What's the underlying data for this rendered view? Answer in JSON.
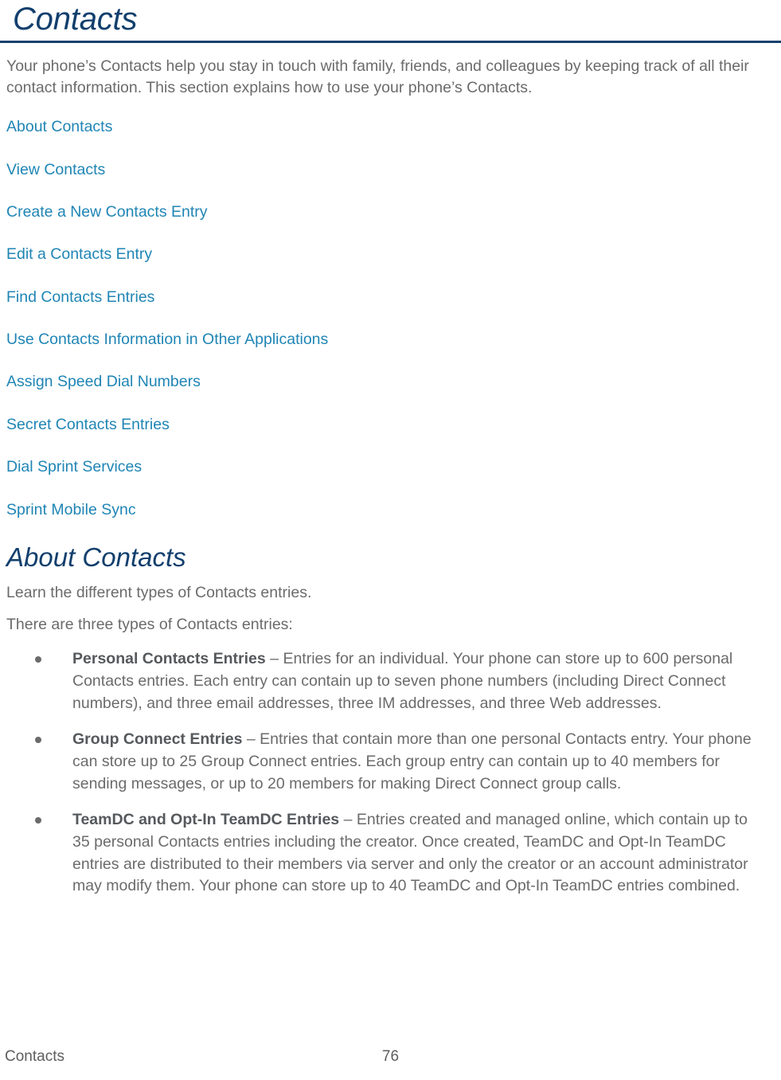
{
  "document": {
    "chapter_title": "Contacts",
    "intro_paragraph": "Your phone’s Contacts help you stay in touch with family, friends, and colleagues by keeping track of all their contact information. This section explains how to use your phone’s Contacts."
  },
  "toc": {
    "items": [
      {
        "label": "About Contacts"
      },
      {
        "label": "View Contacts"
      },
      {
        "label": "Create a New Contacts Entry"
      },
      {
        "label": "Edit a Contacts Entry"
      },
      {
        "label": "Find Contacts Entries"
      },
      {
        "label": "Use Contacts Information in Other Applications"
      },
      {
        "label": "Assign Speed Dial Numbers"
      },
      {
        "label": "Secret Contacts Entries"
      },
      {
        "label": "Dial Sprint Services"
      },
      {
        "label": "Sprint Mobile Sync"
      }
    ]
  },
  "about_section": {
    "heading": "About Contacts",
    "lead_paragraph": "Learn the different types of Contacts entries.",
    "intro_line": "There are three types of Contacts entries:",
    "entries": [
      {
        "term": "Personal Contacts Entries",
        "separator": " – ",
        "description": "Entries for an individual. Your phone can store up to 600 personal Contacts entries. Each entry can contain up to seven phone numbers (including Direct Connect numbers), and three email addresses, three IM addresses, and three Web addresses."
      },
      {
        "term": "Group Connect Entries",
        "separator": " – ",
        "description": "Entries that contain more than one personal Contacts entry. Your phone can store up to 25 Group Connect entries. Each group entry can contain up to 40 members for sending messages, or up to 20 members for making Direct Connect group calls."
      },
      {
        "term": "TeamDC and Opt-In TeamDC Entries",
        "separator": " – ",
        "description": "Entries created and managed online, which contain up to 35 personal Contacts entries including the creator. Once created, TeamDC and Opt-In TeamDC entries are distributed to their members via server and only the creator or an account administrator may modify them. Your phone can store up to 40 TeamDC and Opt-In TeamDC entries combined."
      }
    ]
  },
  "footer": {
    "section_label": "Contacts",
    "page_number": "76"
  },
  "colors": {
    "heading_navy": "#123f6d",
    "link_blue": "#1f85b5",
    "body_gray": "#6b6b6b",
    "rule_navy": "#123f6d"
  }
}
